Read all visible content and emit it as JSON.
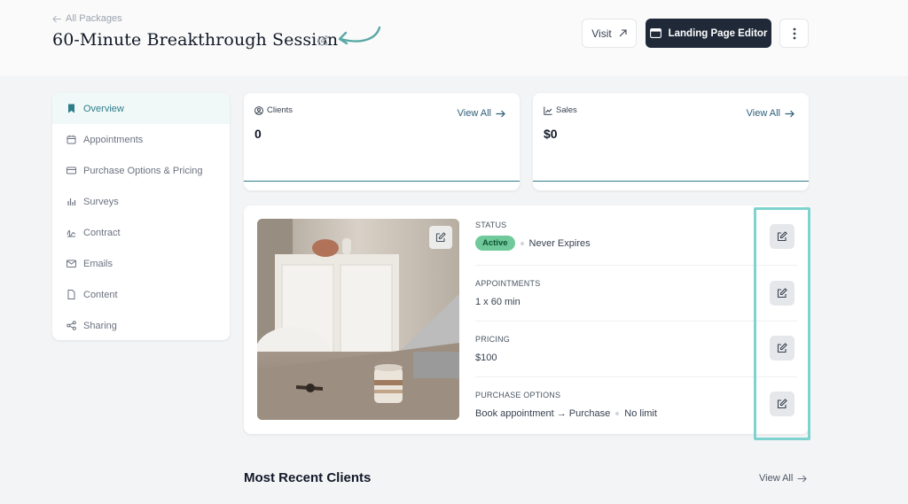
{
  "header": {
    "back_label": "All Packages",
    "title": "60-Minute Breakthrough Session",
    "visit_label": "Visit",
    "editor_label": "Landing Page Editor"
  },
  "sidebar": {
    "items": [
      {
        "label": "Overview",
        "icon": "bookmark-icon",
        "active": true
      },
      {
        "label": "Appointments",
        "icon": "calendar-icon"
      },
      {
        "label": "Purchase Options & Pricing",
        "icon": "credit-card-icon"
      },
      {
        "label": "Surveys",
        "icon": "bar-chart-icon"
      },
      {
        "label": "Contract",
        "icon": "signature-icon"
      },
      {
        "label": "Emails",
        "icon": "mail-icon"
      },
      {
        "label": "Content",
        "icon": "file-icon"
      },
      {
        "label": "Sharing",
        "icon": "share-icon"
      }
    ]
  },
  "stats": {
    "clients": {
      "label": "Clients",
      "value": "0",
      "link": "View All"
    },
    "sales": {
      "label": "Sales",
      "value": "$0",
      "link": "View All"
    }
  },
  "details": {
    "status": {
      "label": "STATUS",
      "badge": "Active",
      "expiry": "Never Expires"
    },
    "appointments": {
      "label": "APPOINTMENTS",
      "value": "1 x 60 min"
    },
    "pricing": {
      "label": "PRICING",
      "value": "$100"
    },
    "purchase_options": {
      "label": "PURCHASE OPTIONS",
      "value": "Book appointment → Purchase",
      "limit": "No limit"
    }
  },
  "recent_clients": {
    "title": "Most Recent Clients",
    "link": "View All"
  },
  "colors": {
    "accent": "#2e7d8a",
    "dark_button": "#1f2937",
    "badge": "#6fc99a",
    "highlight": "#7fd3cf"
  }
}
